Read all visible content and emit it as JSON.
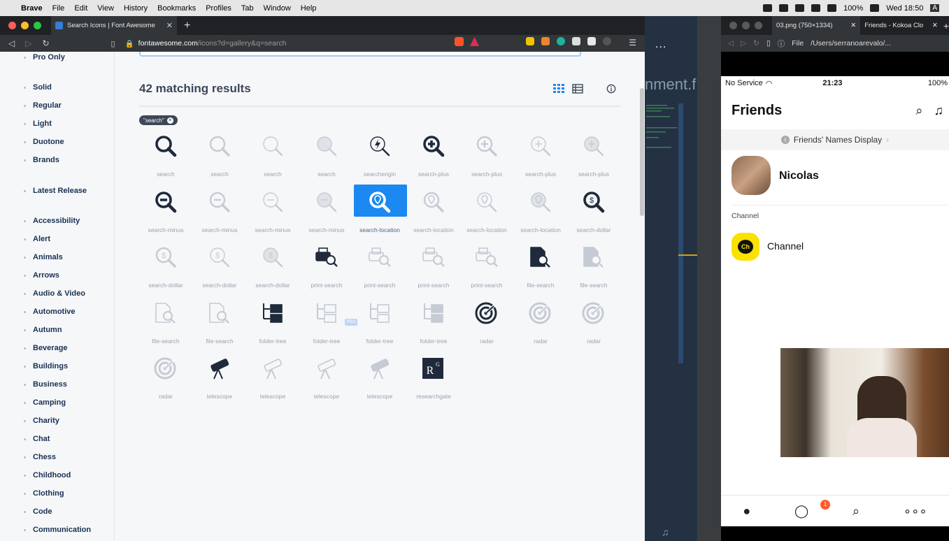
{
  "menubar": {
    "app": "Brave",
    "items": [
      "File",
      "Edit",
      "View",
      "History",
      "Bookmarks",
      "Profiles",
      "Tab",
      "Window",
      "Help"
    ],
    "battery": "100%",
    "clock": "Wed 18:50",
    "user": "A"
  },
  "browser": {
    "tab_title": "Search Icons | Font Awesome",
    "url_host": "fontawesome.com",
    "url_path": "/icons?d=gallery&q=search"
  },
  "sidebar": {
    "items": [
      "Pro Only",
      "Solid",
      "Regular",
      "Light",
      "Duotone",
      "Brands",
      "Latest Release",
      "Accessibility",
      "Alert",
      "Animals",
      "Arrows",
      "Audio & Video",
      "Automotive",
      "Autumn",
      "Beverage",
      "Buildings",
      "Business",
      "Camping",
      "Charity",
      "Chat",
      "Chess",
      "Childhood",
      "Clothing",
      "Code",
      "Communication"
    ]
  },
  "results": {
    "title": "42 matching results",
    "tag": "\"search\"",
    "icons": [
      {
        "label": "search",
        "style": "solid"
      },
      {
        "label": "search",
        "style": "regular"
      },
      {
        "label": "search",
        "style": "light"
      },
      {
        "label": "search",
        "style": "duotone"
      },
      {
        "label": "searchengin",
        "style": "brand"
      },
      {
        "label": "search-plus",
        "style": "solid"
      },
      {
        "label": "search-plus",
        "style": "regular"
      },
      {
        "label": "search-plus",
        "style": "light"
      },
      {
        "label": "search-plus",
        "style": "duotone"
      },
      {
        "label": "search-minus",
        "style": "solid"
      },
      {
        "label": "search-minus",
        "style": "regular"
      },
      {
        "label": "search-minus",
        "style": "light"
      },
      {
        "label": "search-minus",
        "style": "duotone"
      },
      {
        "label": "search-location",
        "style": "selected"
      },
      {
        "label": "search-location",
        "style": "regular"
      },
      {
        "label": "search-location",
        "style": "light"
      },
      {
        "label": "search-location",
        "style": "duotone"
      },
      {
        "label": "search-dollar",
        "style": "solid"
      },
      {
        "label": "search-dollar",
        "style": "regular"
      },
      {
        "label": "search-dollar",
        "style": "light"
      },
      {
        "label": "search-dollar",
        "style": "duotone"
      },
      {
        "label": "print-search",
        "style": "solid"
      },
      {
        "label": "print-search",
        "style": "regular"
      },
      {
        "label": "print-search",
        "style": "light"
      },
      {
        "label": "print-search",
        "style": "duotone"
      },
      {
        "label": "file-search",
        "style": "solid"
      },
      {
        "label": "file-search",
        "style": "regular"
      },
      {
        "label": "file-search",
        "style": "light"
      },
      {
        "label": "file-search",
        "style": "duotone"
      },
      {
        "label": "folder-tree",
        "style": "solid"
      },
      {
        "label": "folder-tree",
        "style": "regular"
      },
      {
        "label": "folder-tree",
        "style": "light"
      },
      {
        "label": "folder-tree",
        "style": "duotone"
      },
      {
        "label": "radar",
        "style": "solid"
      },
      {
        "label": "radar",
        "style": "regular"
      },
      {
        "label": "radar",
        "style": "light"
      },
      {
        "label": "radar",
        "style": "duotone"
      },
      {
        "label": "telescope",
        "style": "solid"
      },
      {
        "label": "telescope",
        "style": "regular"
      },
      {
        "label": "telescope",
        "style": "light"
      },
      {
        "label": "telescope",
        "style": "duotone"
      },
      {
        "label": "researchgate",
        "style": "brand"
      }
    ],
    "pro_badge": "PRO"
  },
  "editor": {
    "fragment": "nment.f",
    "dots": "..."
  },
  "kakao_window": {
    "tab1": "03.png (750×1334)",
    "tab2": "Friends - Kokoa Clo",
    "url_prefix": "File",
    "url": "/Users/serranoarevalo/...",
    "status_left": "No Service",
    "status_time": "21:23",
    "status_right": "100%",
    "title": "Friends",
    "names_display": "Friends' Names Display",
    "friend_name": "Nicolas",
    "channel_header": "Channel",
    "channel_name": "Channel",
    "channel_logo": "Ch",
    "chat_badge": "1"
  }
}
